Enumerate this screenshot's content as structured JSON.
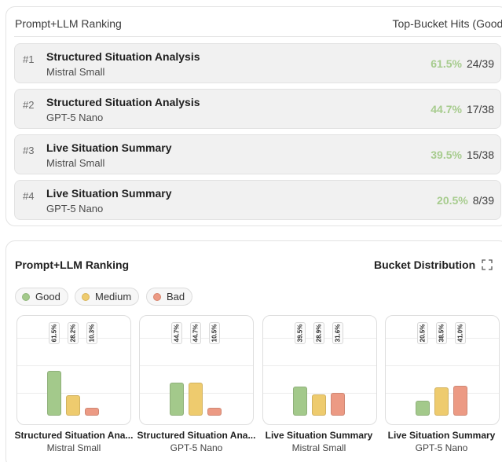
{
  "ranking": {
    "title": "Prompt+LLM Ranking",
    "metric_label": "Top-Bucket Hits (Good)",
    "items": [
      {
        "rank": "#1",
        "name": "Structured Situation Analysis",
        "model": "Mistral Small",
        "pct": "61.5%",
        "count": "24/39"
      },
      {
        "rank": "#2",
        "name": "Structured Situation Analysis",
        "model": "GPT-5 Nano",
        "pct": "44.7%",
        "count": "17/38"
      },
      {
        "rank": "#3",
        "name": "Live Situation Summary",
        "model": "Mistral Small",
        "pct": "39.5%",
        "count": "15/38"
      },
      {
        "rank": "#4",
        "name": "Live Situation Summary",
        "model": "GPT-5 Nano",
        "pct": "20.5%",
        "count": "8/39"
      }
    ]
  },
  "distribution": {
    "title": "Prompt+LLM Ranking",
    "subtitle": "Bucket Distribution",
    "expand_icon": "expand-icon",
    "legend": [
      {
        "label": "Good",
        "color": "#a3c98b"
      },
      {
        "label": "Medium",
        "color": "#eecb6e"
      },
      {
        "label": "Bad",
        "color": "#ec9a84"
      }
    ]
  },
  "chart_data": {
    "type": "bar",
    "series_names": [
      "Good",
      "Medium",
      "Bad"
    ],
    "colors": [
      "#a3c98b",
      "#eecb6e",
      "#ec9a84"
    ],
    "ylim": [
      0,
      100
    ],
    "charts": [
      {
        "name": "Structured Situation Ana...",
        "model": "Mistral Small",
        "values": [
          61.5,
          28.2,
          10.3
        ],
        "labels": [
          "61.5%",
          "28.2%",
          "10.3%"
        ]
      },
      {
        "name": "Structured Situation Ana...",
        "model": "GPT-5 Nano",
        "values": [
          44.7,
          44.7,
          10.5
        ],
        "labels": [
          "44.7%",
          "44.7%",
          "10.5%"
        ]
      },
      {
        "name": "Live Situation Summary",
        "model": "Mistral Small",
        "values": [
          39.5,
          28.9,
          31.6
        ],
        "labels": [
          "39.5%",
          "28.9%",
          "31.6%"
        ]
      },
      {
        "name": "Live Situation Summary",
        "model": "GPT-5 Nano",
        "values": [
          20.5,
          38.5,
          41.0
        ],
        "labels": [
          "20.5%",
          "38.5%",
          "41.0%"
        ]
      }
    ]
  }
}
